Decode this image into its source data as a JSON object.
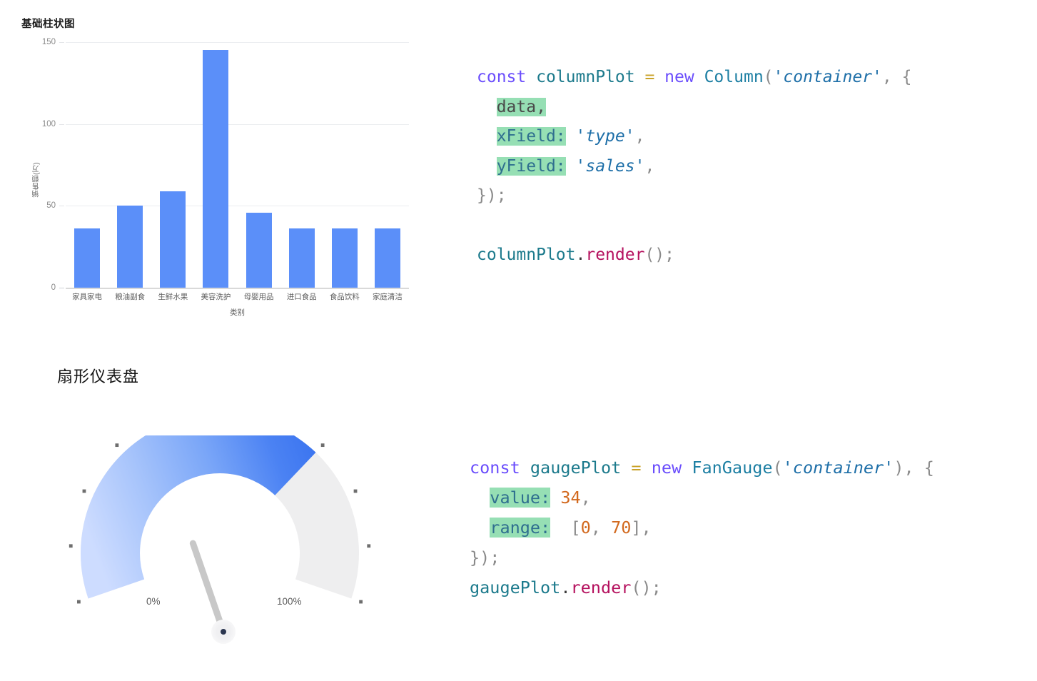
{
  "sections": {
    "bar": {
      "title": "基础柱状图"
    },
    "gauge": {
      "title": "扇形仪表盘",
      "min_label": "0%",
      "max_label": "100%"
    }
  },
  "chart_data": [
    {
      "type": "bar",
      "title": "基础柱状图",
      "xlabel": "类别",
      "ylabel": "销售额(万)",
      "categories": [
        "家具家电",
        "粮油副食",
        "生鲜水果",
        "美容洗护",
        "母婴用品",
        "进口食品",
        "食品饮料",
        "家庭清洁"
      ],
      "values": [
        36,
        50,
        59,
        145,
        46,
        36,
        36,
        36
      ],
      "yticks": [
        "0",
        "50",
        "100",
        "150"
      ],
      "ylim": [
        0,
        150
      ],
      "grid": true,
      "legend": "none",
      "bar_color": "#5b8ff9"
    },
    {
      "type": "gauge",
      "title": "扇形仪表盘",
      "value": 34,
      "range": [
        0,
        70
      ],
      "percent_of_sweep": 0.7,
      "min_label": "0%",
      "max_label": "100%",
      "tick_count": 11,
      "fill_color_start": "#c6daff",
      "fill_color_end": "#3d76f0",
      "track_color": "#eeeeef",
      "needle_color": "#c8c8c8"
    }
  ],
  "code_blocks": [
    {
      "name": "column-plot-code",
      "lines": [
        {
          "tokens": [
            {
              "t": "const",
              "c": "tok-kw"
            },
            {
              "t": " ",
              "c": "tok-punct"
            },
            {
              "t": "columnPlot",
              "c": "tok-var"
            },
            {
              "t": " ",
              "c": "tok-punct"
            },
            {
              "t": "=",
              "c": "tok-op"
            },
            {
              "t": " ",
              "c": "tok-punct"
            },
            {
              "t": "new",
              "c": "tok-kw"
            },
            {
              "t": " ",
              "c": "tok-punct"
            },
            {
              "t": "Column",
              "c": "tok-cls"
            },
            {
              "t": "(",
              "c": "tok-punct"
            },
            {
              "t": "'",
              "c": "tok-quote"
            },
            {
              "t": "container",
              "c": "tok-str"
            },
            {
              "t": "'",
              "c": "tok-quote"
            },
            {
              "t": ",",
              "c": "tok-punct"
            },
            {
              "t": " ",
              "c": "tok-punct"
            },
            {
              "t": "{",
              "c": "tok-brace"
            }
          ]
        },
        {
          "tokens": [
            {
              "t": "  ",
              "c": "tok-punct"
            },
            {
              "t": "data,",
              "c": "tok-prop"
            }
          ]
        },
        {
          "tokens": [
            {
              "t": "  ",
              "c": "tok-punct"
            },
            {
              "t": "xField:",
              "c": "tok-prop-col"
            },
            {
              "t": " ",
              "c": "tok-punct"
            },
            {
              "t": "'",
              "c": "tok-quote"
            },
            {
              "t": "type",
              "c": "tok-str"
            },
            {
              "t": "'",
              "c": "tok-quote"
            },
            {
              "t": ",",
              "c": "tok-punct"
            }
          ]
        },
        {
          "tokens": [
            {
              "t": "  ",
              "c": "tok-punct"
            },
            {
              "t": "yField:",
              "c": "tok-prop-col"
            },
            {
              "t": " ",
              "c": "tok-punct"
            },
            {
              "t": "'",
              "c": "tok-quote"
            },
            {
              "t": "sales",
              "c": "tok-str"
            },
            {
              "t": "'",
              "c": "tok-quote"
            },
            {
              "t": ",",
              "c": "tok-punct"
            }
          ]
        },
        {
          "tokens": [
            {
              "t": "});",
              "c": "tok-brace"
            }
          ]
        },
        {
          "tokens": [
            {
              "t": " ",
              "c": "tok-punct"
            }
          ]
        },
        {
          "tokens": [
            {
              "t": "columnPlot",
              "c": "tok-var"
            },
            {
              "t": ".",
              "c": "tok-dot"
            },
            {
              "t": "render",
              "c": "tok-method"
            },
            {
              "t": "();",
              "c": "tok-punct"
            }
          ]
        }
      ]
    },
    {
      "name": "gauge-plot-code",
      "lines": [
        {
          "tokens": [
            {
              "t": "const",
              "c": "tok-kw"
            },
            {
              "t": " ",
              "c": "tok-punct"
            },
            {
              "t": "gaugePlot",
              "c": "tok-var"
            },
            {
              "t": " ",
              "c": "tok-punct"
            },
            {
              "t": "=",
              "c": "tok-op"
            },
            {
              "t": " ",
              "c": "tok-punct"
            },
            {
              "t": "new",
              "c": "tok-kw"
            },
            {
              "t": " ",
              "c": "tok-punct"
            },
            {
              "t": "FanGauge",
              "c": "tok-cls"
            },
            {
              "t": "(",
              "c": "tok-punct"
            },
            {
              "t": "'",
              "c": "tok-quote"
            },
            {
              "t": "container",
              "c": "tok-str"
            },
            {
              "t": "'",
              "c": "tok-quote"
            },
            {
              "t": "),",
              "c": "tok-punct"
            },
            {
              "t": " ",
              "c": "tok-punct"
            },
            {
              "t": "{",
              "c": "tok-brace"
            }
          ]
        },
        {
          "tokens": [
            {
              "t": "  ",
              "c": "tok-punct"
            },
            {
              "t": "value:",
              "c": "tok-prop-col"
            },
            {
              "t": " ",
              "c": "tok-punct"
            },
            {
              "t": "34",
              "c": "tok-num"
            },
            {
              "t": ",",
              "c": "tok-punct"
            }
          ]
        },
        {
          "tokens": [
            {
              "t": "  ",
              "c": "tok-punct"
            },
            {
              "t": "range:",
              "c": "tok-prop-col"
            },
            {
              "t": "  ",
              "c": "tok-punct"
            },
            {
              "t": "[",
              "c": "tok-punct"
            },
            {
              "t": "0",
              "c": "tok-num"
            },
            {
              "t": ", ",
              "c": "tok-punct"
            },
            {
              "t": "70",
              "c": "tok-num"
            },
            {
              "t": "],",
              "c": "tok-punct"
            }
          ]
        },
        {
          "tokens": [
            {
              "t": "});",
              "c": "tok-brace"
            }
          ]
        },
        {
          "tokens": [
            {
              "t": "gaugePlot",
              "c": "tok-var"
            },
            {
              "t": ".",
              "c": "tok-dot"
            },
            {
              "t": "render",
              "c": "tok-method"
            },
            {
              "t": "();",
              "c": "tok-punct"
            }
          ]
        }
      ]
    }
  ]
}
